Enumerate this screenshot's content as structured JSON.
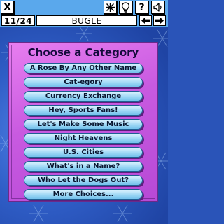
{
  "topbar": {
    "close_label": "X",
    "icons": [
      "snowflake-icon",
      "lightbulb-icon",
      "help-icon",
      "speaker-icon"
    ]
  },
  "navbar": {
    "counter": "11/24",
    "word": "BUGLE",
    "icons": [
      "arrow-left-icon",
      "arrow-right-icon"
    ]
  },
  "menu": {
    "title": "Choose a Category",
    "items": [
      "A Rose By Any Other Name",
      "Cat-egory",
      "Currency Exchange",
      "Hey, Sports Fans!",
      "Let's Make Some Music",
      "Night Heavens",
      "U.S. Cities",
      "What's in a Name?",
      "Who Let the Dogs Out?",
      "More Choices..."
    ]
  },
  "colors": {
    "background": "#2f5dc6",
    "bar": "#5aa8ec",
    "panel": "#c85ae0",
    "button": "#9ed8f5",
    "title_text": "#140a3c"
  }
}
